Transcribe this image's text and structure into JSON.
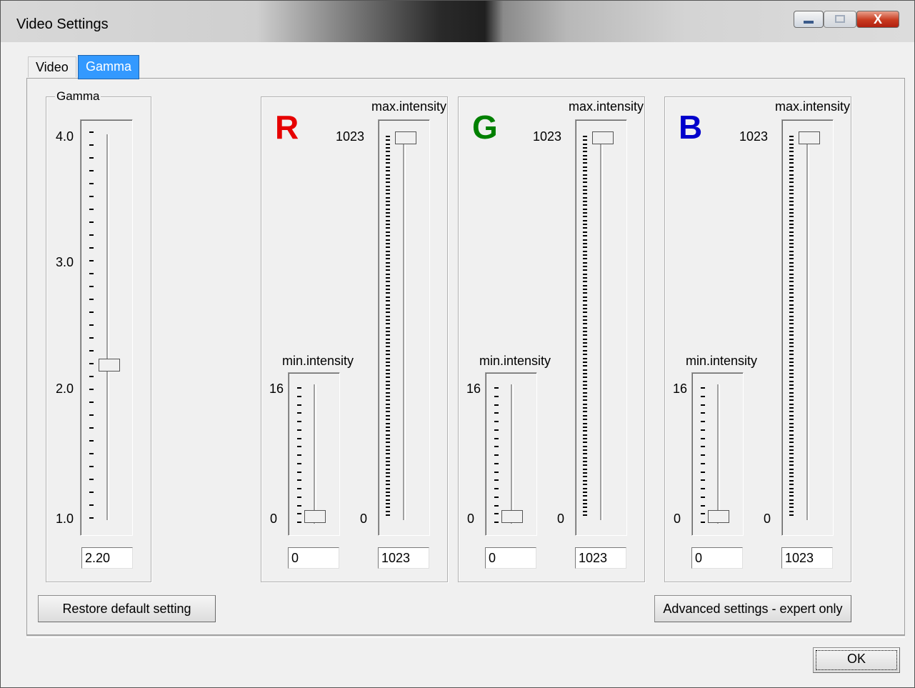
{
  "window": {
    "title": "Video Settings",
    "close_glyph": "X"
  },
  "tabs": [
    {
      "label": "Video"
    },
    {
      "label": "Gamma"
    }
  ],
  "gamma": {
    "legend": "Gamma",
    "ticks": [
      "4.0",
      "3.0",
      "2.0",
      "1.0"
    ],
    "value": "2.20",
    "slider_level": 0.4
  },
  "channels": [
    {
      "letter": "R",
      "color": "#e60000",
      "max": {
        "label": "max.intensity",
        "top_value": "1023",
        "bottom_value": "0",
        "value": "1023"
      },
      "min": {
        "label": "min.intensity",
        "top_value": "16",
        "bottom_value": "0",
        "value": "0"
      }
    },
    {
      "letter": "G",
      "color": "#008000",
      "max": {
        "label": "max.intensity",
        "top_value": "1023",
        "bottom_value": "0",
        "value": "1023"
      },
      "min": {
        "label": "min.intensity",
        "top_value": "16",
        "bottom_value": "0",
        "value": "0"
      }
    },
    {
      "letter": "B",
      "color": "#0000cc",
      "max": {
        "label": "max.intensity",
        "top_value": "1023",
        "bottom_value": "0",
        "value": "1023"
      },
      "min": {
        "label": "min.intensity",
        "top_value": "16",
        "bottom_value": "0",
        "value": "0"
      }
    }
  ],
  "buttons": {
    "restore": "Restore default setting",
    "advanced": "Advanced settings - expert only",
    "ok": "OK"
  }
}
